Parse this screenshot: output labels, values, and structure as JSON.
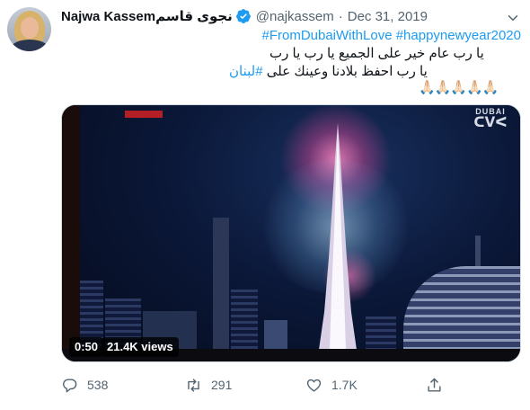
{
  "tweet": {
    "display_name": "Najwa Kassemنجوى قاسم",
    "handle": "@najkassem",
    "separator": "·",
    "date": "Dec 31, 2019",
    "hashtags_line": "#FromDubaiWithLove #happynewyear2020",
    "text_line_1": "يا رب عام خير على الجميع يا رب يا رب",
    "text_line_2_prefix": "يا رب احفظ بلادنا وعينك على ",
    "text_line_2_hashtag": "#لبنان",
    "emoji_line": "🙏🏻🙏🏻🙏🏻🙏🏻🙏🏻",
    "colors": {
      "link": "#1d9bf0",
      "text": "#0f1419",
      "muted": "#536471",
      "verified": "#1d9bf0"
    }
  },
  "media": {
    "type": "video",
    "channel_text": "DUBAI",
    "duration": "0:50",
    "views": "21.4K views"
  },
  "actions": {
    "reply_icon": "reply-icon",
    "reply_count": "538",
    "retweet_icon": "retweet-icon",
    "retweet_count": "291",
    "like_icon": "heart-icon",
    "like_count": "1.7K",
    "share_icon": "share-icon"
  }
}
